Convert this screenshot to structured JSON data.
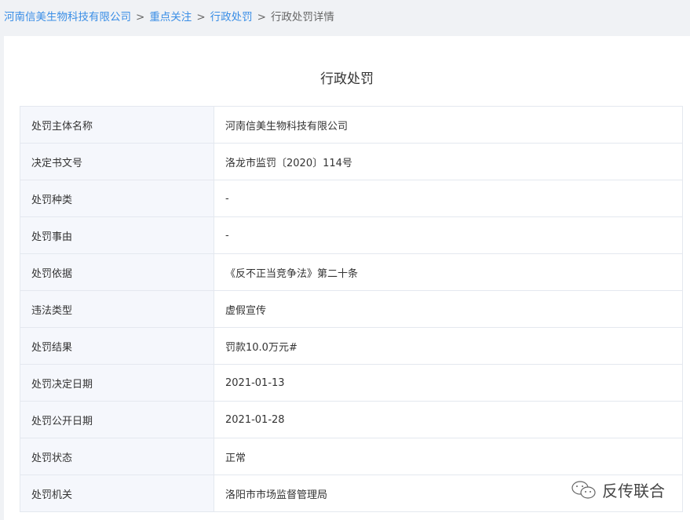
{
  "breadcrumb": [
    {
      "label": "河南信美生物科技有限公司",
      "link": true
    },
    {
      "label": "重点关注",
      "link": true
    },
    {
      "label": "行政处罚",
      "link": true
    },
    {
      "label": "行政处罚详情",
      "link": false
    }
  ],
  "separator": ">",
  "title": "行政处罚",
  "rows": [
    {
      "k": "处罚主体名称",
      "v": "河南信美生物科技有限公司"
    },
    {
      "k": "决定书文号",
      "v": "洛龙市监罚〔2020〕114号"
    },
    {
      "k": "处罚种类",
      "v": "-"
    },
    {
      "k": "处罚事由",
      "v": "-"
    },
    {
      "k": "处罚依据",
      "v": "《反不正当竞争法》第二十条"
    },
    {
      "k": "违法类型",
      "v": "虚假宣传"
    },
    {
      "k": "处罚结果",
      "v": "罚款10.0万元#"
    },
    {
      "k": "处罚决定日期",
      "v": "2021-01-13"
    },
    {
      "k": "处罚公开日期",
      "v": "2021-01-28"
    },
    {
      "k": "处罚状态",
      "v": "正常"
    },
    {
      "k": "处罚机关",
      "v": "洛阳市市场监督管理局"
    }
  ],
  "watermark": {
    "text": "反传联合",
    "icon": "wechat-icon"
  }
}
